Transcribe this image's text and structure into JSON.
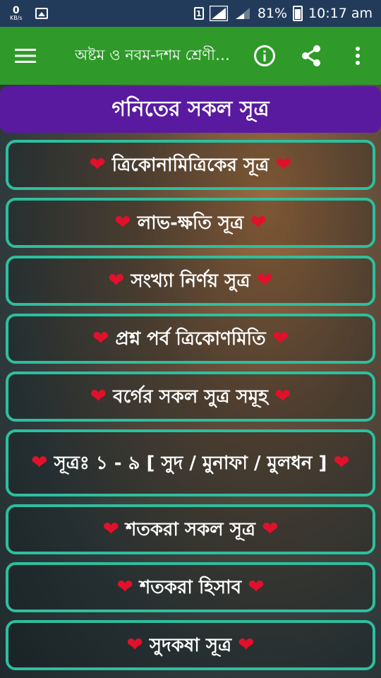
{
  "status_bar": {
    "net_speed_value": "0",
    "net_speed_unit": "KB/s",
    "sim_label": "1",
    "battery": "81%",
    "time": "10:17 am"
  },
  "toolbar": {
    "title": "অষ্টম ও নবম-দশম শ্রেণীর গণিত সূত্র"
  },
  "header": {
    "title": "গনিতের সকল সূত্র"
  },
  "items": [
    {
      "label": "ত্রিকোনামিত্রিকের সূত্র"
    },
    {
      "label": "লাভ-ক্ষতি সূত্র"
    },
    {
      "label": "সংখ্যা নির্ণয় সুত্র"
    },
    {
      "label": "প্রশ্ন পর্ব ত্রিকোণমিতি"
    },
    {
      "label": "বর্গের সকল সুত্র সমূহ"
    },
    {
      "label": "সূত্রঃ ১ - ৯ [ সুদ / মুনাফা / মুলধন ]"
    },
    {
      "label": "শতকরা সকল সূত্র"
    },
    {
      "label": "শতকরা হিসাব"
    },
    {
      "label": "সুদকষা সূত্র"
    }
  ],
  "colors": {
    "status_bar": "#223b5a",
    "toolbar": "#2f9a29",
    "header": "#5a1aa0",
    "item_border": "#2dbf9e",
    "heart": "#e3102b"
  },
  "icons": {
    "menu": "hamburger-icon",
    "info": "info-icon",
    "share": "share-icon",
    "more": "more-vert-icon",
    "heart": "heart-icon"
  }
}
